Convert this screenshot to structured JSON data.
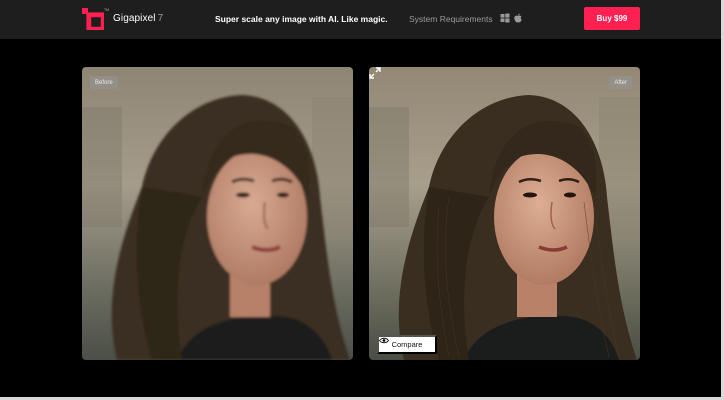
{
  "header": {
    "brand_name": "Gigapixel",
    "brand_version": "7",
    "logo_tm": "TM",
    "tagline": "Super scale any image with AI. Like magic.",
    "system_requirements": "System Requirements",
    "os_icons": [
      "windows-icon",
      "apple-icon"
    ],
    "buy_label": "Buy  $99"
  },
  "comparison": {
    "before_label": "Before",
    "after_label": "After",
    "compare_label": "Compare"
  },
  "colors": {
    "accent": "#ff2052",
    "header_bg": "#1e1e1e",
    "page_bg": "#000000"
  }
}
